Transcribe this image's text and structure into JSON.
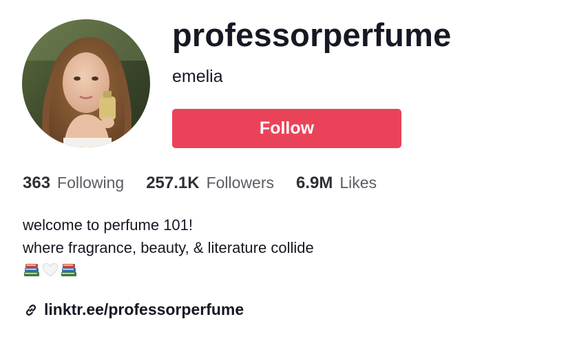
{
  "profile": {
    "username": "professorperfume",
    "nickname": "emelia",
    "follow_label": "Follow",
    "avatar_icon": "profile-photo"
  },
  "stats": {
    "following": {
      "count": "363",
      "label": "Following"
    },
    "followers": {
      "count": "257.1K",
      "label": "Followers"
    },
    "likes": {
      "count": "6.9M",
      "label": "Likes"
    }
  },
  "bio": {
    "line1": "welcome to perfume 101!",
    "line2": "where fragrance, beauty, & literature collide",
    "emojis": [
      "books-emoji",
      "white-heart-emoji",
      "books-emoji"
    ]
  },
  "link": {
    "icon": "link-icon",
    "text": "linktr.ee/professorperfume"
  },
  "colors": {
    "accent": "#ea4359",
    "text_primary": "#161823",
    "text_secondary": "#5b5c63"
  }
}
